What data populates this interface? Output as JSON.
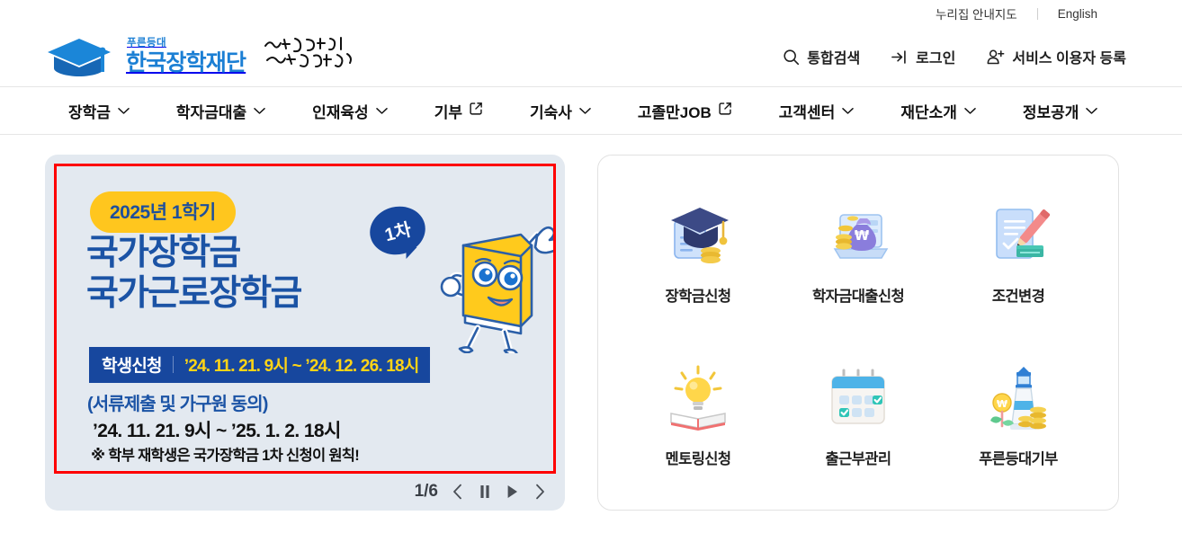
{
  "utility": {
    "links": [
      {
        "label": "누리집 안내지도",
        "name": "nurijip-sitemap-link"
      },
      {
        "label": "English",
        "name": "english-link"
      }
    ]
  },
  "header": {
    "logo": {
      "sub": "푸른등대",
      "main": "한국장학재단",
      "slogan": "다시 대한민국! 새로운 국민의 나라",
      "brand_color": "#1b7fd4"
    },
    "utils": [
      {
        "label": "통합검색",
        "icon": "search-icon"
      },
      {
        "label": "로그인",
        "icon": "login-icon"
      },
      {
        "label": "서비스 이용자 등록",
        "icon": "user-plus-icon"
      }
    ]
  },
  "nav": {
    "items": [
      {
        "label": "장학금",
        "icon": "chevron-down-icon"
      },
      {
        "label": "학자금대출",
        "icon": "chevron-down-icon"
      },
      {
        "label": "인재육성",
        "icon": "chevron-down-icon"
      },
      {
        "label": "기부",
        "icon": "external-link-icon"
      },
      {
        "label": "기숙사",
        "icon": "chevron-down-icon"
      },
      {
        "label": "고졸만JOB",
        "icon": "external-link-icon"
      },
      {
        "label": "고객센터",
        "icon": "chevron-down-icon"
      },
      {
        "label": "재단소개",
        "icon": "chevron-down-icon"
      },
      {
        "label": "정보공개",
        "icon": "chevron-down-icon"
      }
    ]
  },
  "banner": {
    "pill": "2025년 1학기",
    "headline": "국가장학금\n국가근로장학금",
    "bubble": "1차",
    "apply_label": "학생신청",
    "apply_period": "’24. 11. 21. 9시 ~ ’24. 12. 26. 18시",
    "sub_title": "(서류제출 및 가구원 동의)",
    "sub_period": "’24. 11. 21. 9시 ~ ’25. 1. 2. 18시",
    "note": "※ 학부 재학생은 국가장학금 1차 신청이 원칙!",
    "colors": {
      "pill_bg": "#ffc61e",
      "headline": "#1b53a5",
      "navy": "#17479e",
      "date_yellow": "#ffd416",
      "border_red": "#fe0000",
      "panel_bg": "#e3e9f0"
    },
    "carousel": {
      "counter": "1/6",
      "prev": "이전",
      "pause": "정지",
      "play": "재생",
      "next": "다음"
    }
  },
  "quick_menu": {
    "items": [
      {
        "label": "장학금신청",
        "icon": "graduation-cap-document-coins-icon"
      },
      {
        "label": "학자금대출신청",
        "icon": "laptop-moneybag-won-icon"
      },
      {
        "label": "조건변경",
        "icon": "document-pencil-cash-icon"
      },
      {
        "label": "멘토링신청",
        "icon": "lightbulb-open-book-icon"
      },
      {
        "label": "출근부관리",
        "icon": "calendar-check-icon"
      },
      {
        "label": "푸른등대기부",
        "icon": "lighthouse-coins-icon"
      }
    ]
  }
}
